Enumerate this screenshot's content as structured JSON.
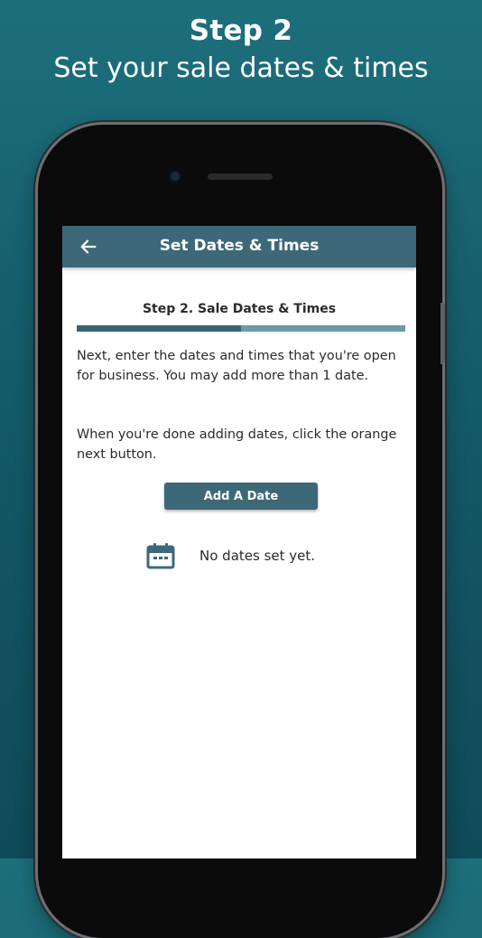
{
  "promo": {
    "headline": "Step 2",
    "subheadline": "Set your sale dates & times"
  },
  "appbar": {
    "title": "Set Dates & Times",
    "back_icon": "arrow-left-icon"
  },
  "content": {
    "step_title": "Step 2. Sale Dates & Times",
    "progress_fraction": 0.5,
    "paragraph_1": "Next, enter the dates and times that you're open for business. You may add more than 1 date.",
    "paragraph_2": "When you're done adding dates, click the orange next button.",
    "add_button_label": "Add A Date",
    "empty_state": {
      "icon": "calendar-icon",
      "text": "No dates set yet."
    }
  },
  "colors": {
    "background_teal": "#1d6f7c",
    "appbar": "#3c6878",
    "progress_done": "#3a6472",
    "progress_remaining": "#6a9aa8"
  }
}
